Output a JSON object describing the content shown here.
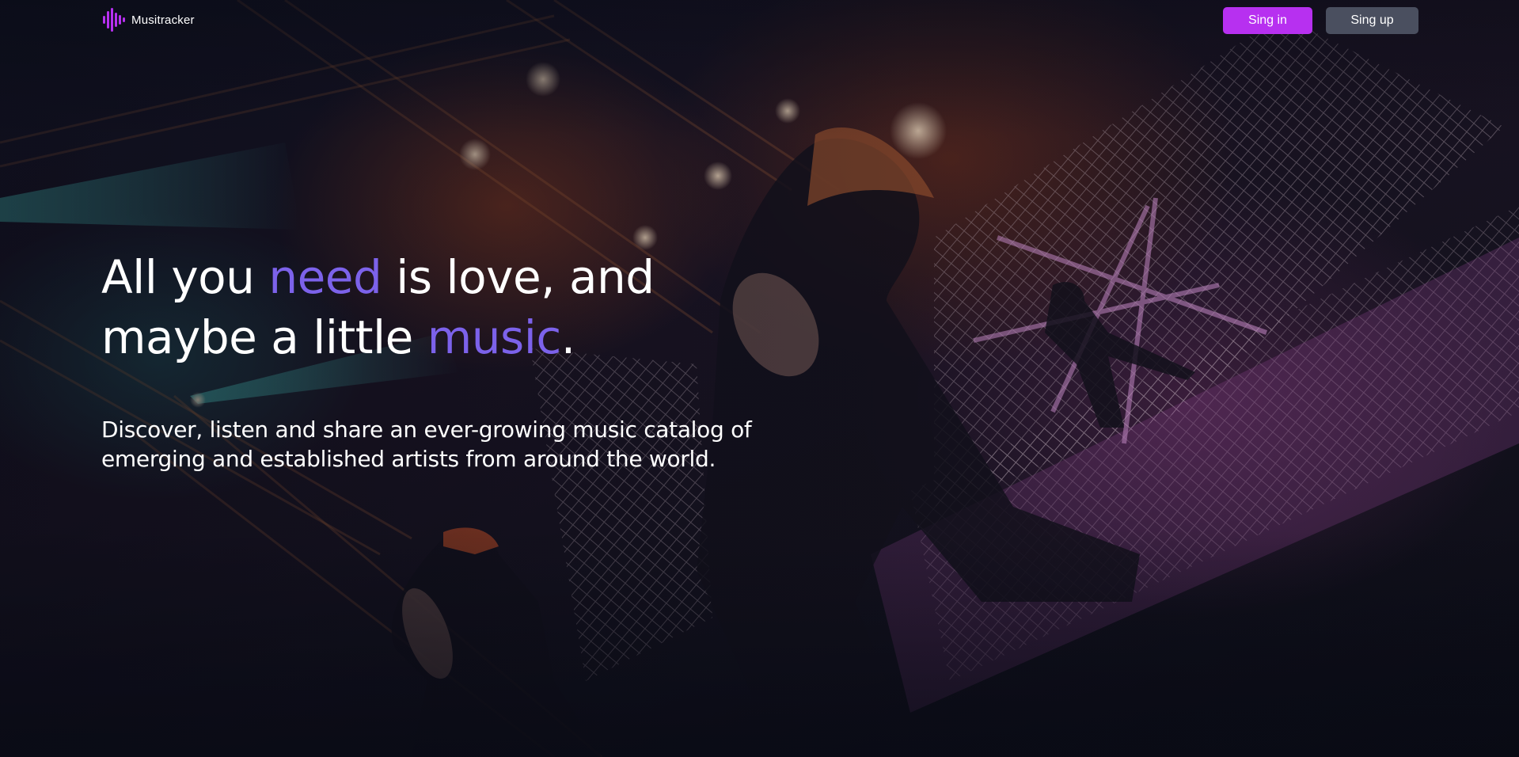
{
  "brand": {
    "name": "Musitracker",
    "logo_icon": "soundwave-icon",
    "accent_color": "#b730f0"
  },
  "nav": {
    "signin_label": "Sing in",
    "signup_label": "Sing up"
  },
  "hero": {
    "title_line1_part1": "All you ",
    "title_line1_accent": "need",
    "title_line1_part2": " is love, and",
    "title_line2_part1": "maybe a little ",
    "title_line2_accent": "music",
    "title_line2_part2": ".",
    "subtitle": "Discover, listen and share an ever-growing music catalog of emerging and established artists from around the world.",
    "accent_color": "#7c62ea",
    "background_image": "concert-stage-photo"
  }
}
